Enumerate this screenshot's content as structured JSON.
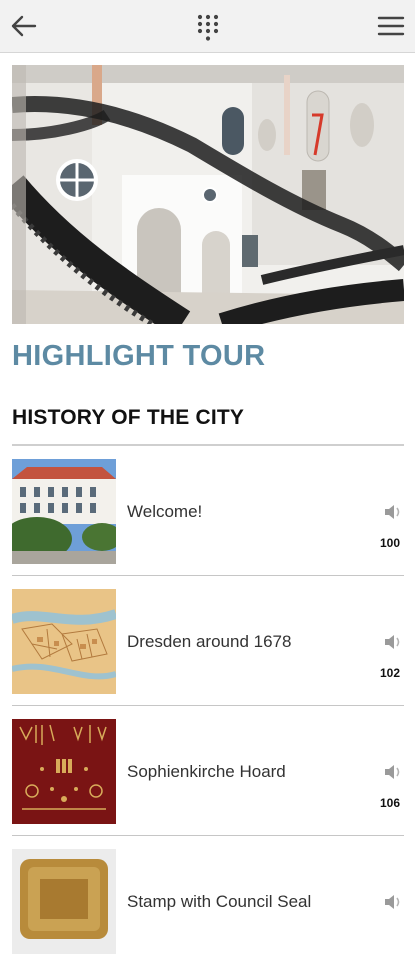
{
  "header": {
    "back_icon": "arrow-left-icon",
    "keypad_icon": "keypad-icon",
    "menu_icon": "hamburger-menu-icon"
  },
  "hero": {
    "image": "baroque-staircase-photo"
  },
  "tour": {
    "title": "HIGHLIGHT TOUR"
  },
  "section": {
    "title": "HISTORY OF THE CITY"
  },
  "stops": [
    {
      "title": "Welcome!",
      "number": "100",
      "thumb": "palace-building-photo"
    },
    {
      "title": "Dresden around 1678",
      "number": "102",
      "thumb": "historic-city-map"
    },
    {
      "title": "Sophienkirche Hoard",
      "number": "106",
      "thumb": "gold-jewelry-on-red"
    },
    {
      "title": "Stamp with Council Seal",
      "number": "",
      "thumb": "gold-seal-stamp"
    }
  ],
  "colors": {
    "accent": "#5d8aa3",
    "topbar": "#f2f2f2",
    "icon": "#444444"
  }
}
